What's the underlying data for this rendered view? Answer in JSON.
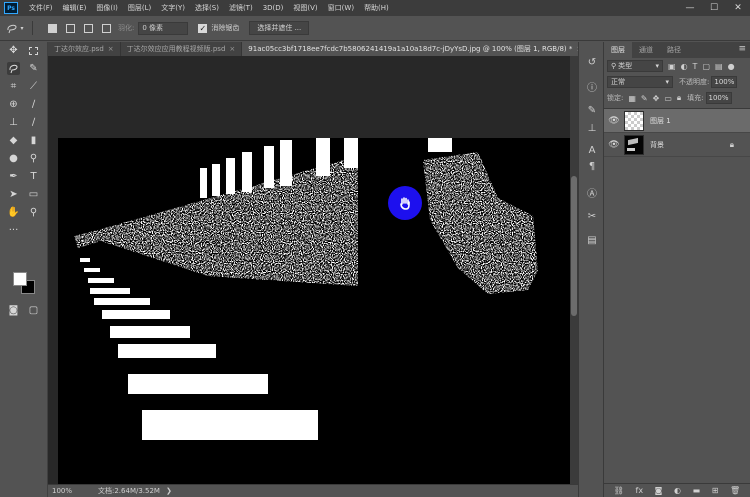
{
  "app": {
    "logo": "Ps"
  },
  "menu": [
    "文件(F)",
    "编辑(E)",
    "图像(I)",
    "图层(L)",
    "文字(Y)",
    "选择(S)",
    "滤镜(T)",
    "3D(D)",
    "视图(V)",
    "窗口(W)",
    "帮助(H)"
  ],
  "window_controls": {
    "minimize": "—",
    "maximize": "☐",
    "close": "✕"
  },
  "options": {
    "feather_label": "羽化:",
    "feather_value": "0 像素",
    "antialias_label": "消除锯齿",
    "antialias_checked": "✓",
    "select_mask_label": "选择并遮住 ..."
  },
  "tabs": [
    {
      "label": "丁达尔效应.psd",
      "close": "×"
    },
    {
      "label": "丁达尔效应应用教程视频版.psd",
      "close": "×"
    },
    {
      "label": "91ac05cc3bf1718ee7fcdc7b5806241419a1a10a18d7c-jDyYsD.jpg @ 100% (图层 1, RGB/8) *",
      "close": "×"
    }
  ],
  "status": {
    "zoom": "100%",
    "doc_info": "文档:2.64M/3.52M",
    "arrow": "❯"
  },
  "colors": {
    "foreground": "#ffffff",
    "background": "#000000",
    "hand_cursor": "#1d10ee"
  },
  "layers_panel": {
    "tabs": [
      "图层",
      "通道",
      "路径"
    ],
    "menu_icon": "≡",
    "filter_kind": "类型",
    "blend_mode": "正常",
    "opacity_label": "不透明度:",
    "opacity_value": "100%",
    "lock_label": "锁定:",
    "fill_label": "填充:",
    "fill_value": "100%",
    "layers": [
      {
        "name": "图层 1",
        "selected": true
      },
      {
        "name": "背景",
        "selected": false
      }
    ]
  },
  "icons": {
    "toolbar": [
      "move-icon",
      "marquee-icon",
      "lasso-icon",
      "quick-select-icon",
      "crop-icon",
      "eyedropper-icon",
      "healing-icon",
      "brush-icon",
      "stamp-icon",
      "history-brush-icon",
      "eraser-icon",
      "gradient-icon",
      "blur-icon",
      "dodge-icon",
      "pen-icon",
      "type-icon",
      "path-select-icon",
      "rectangle-icon",
      "hand-icon",
      "zoom-icon"
    ],
    "strip": [
      "history-icon",
      "info-icon",
      "character-icon",
      "paragraph-icon",
      "glyphs-icon",
      "tools-icon",
      "styles-icon"
    ]
  }
}
